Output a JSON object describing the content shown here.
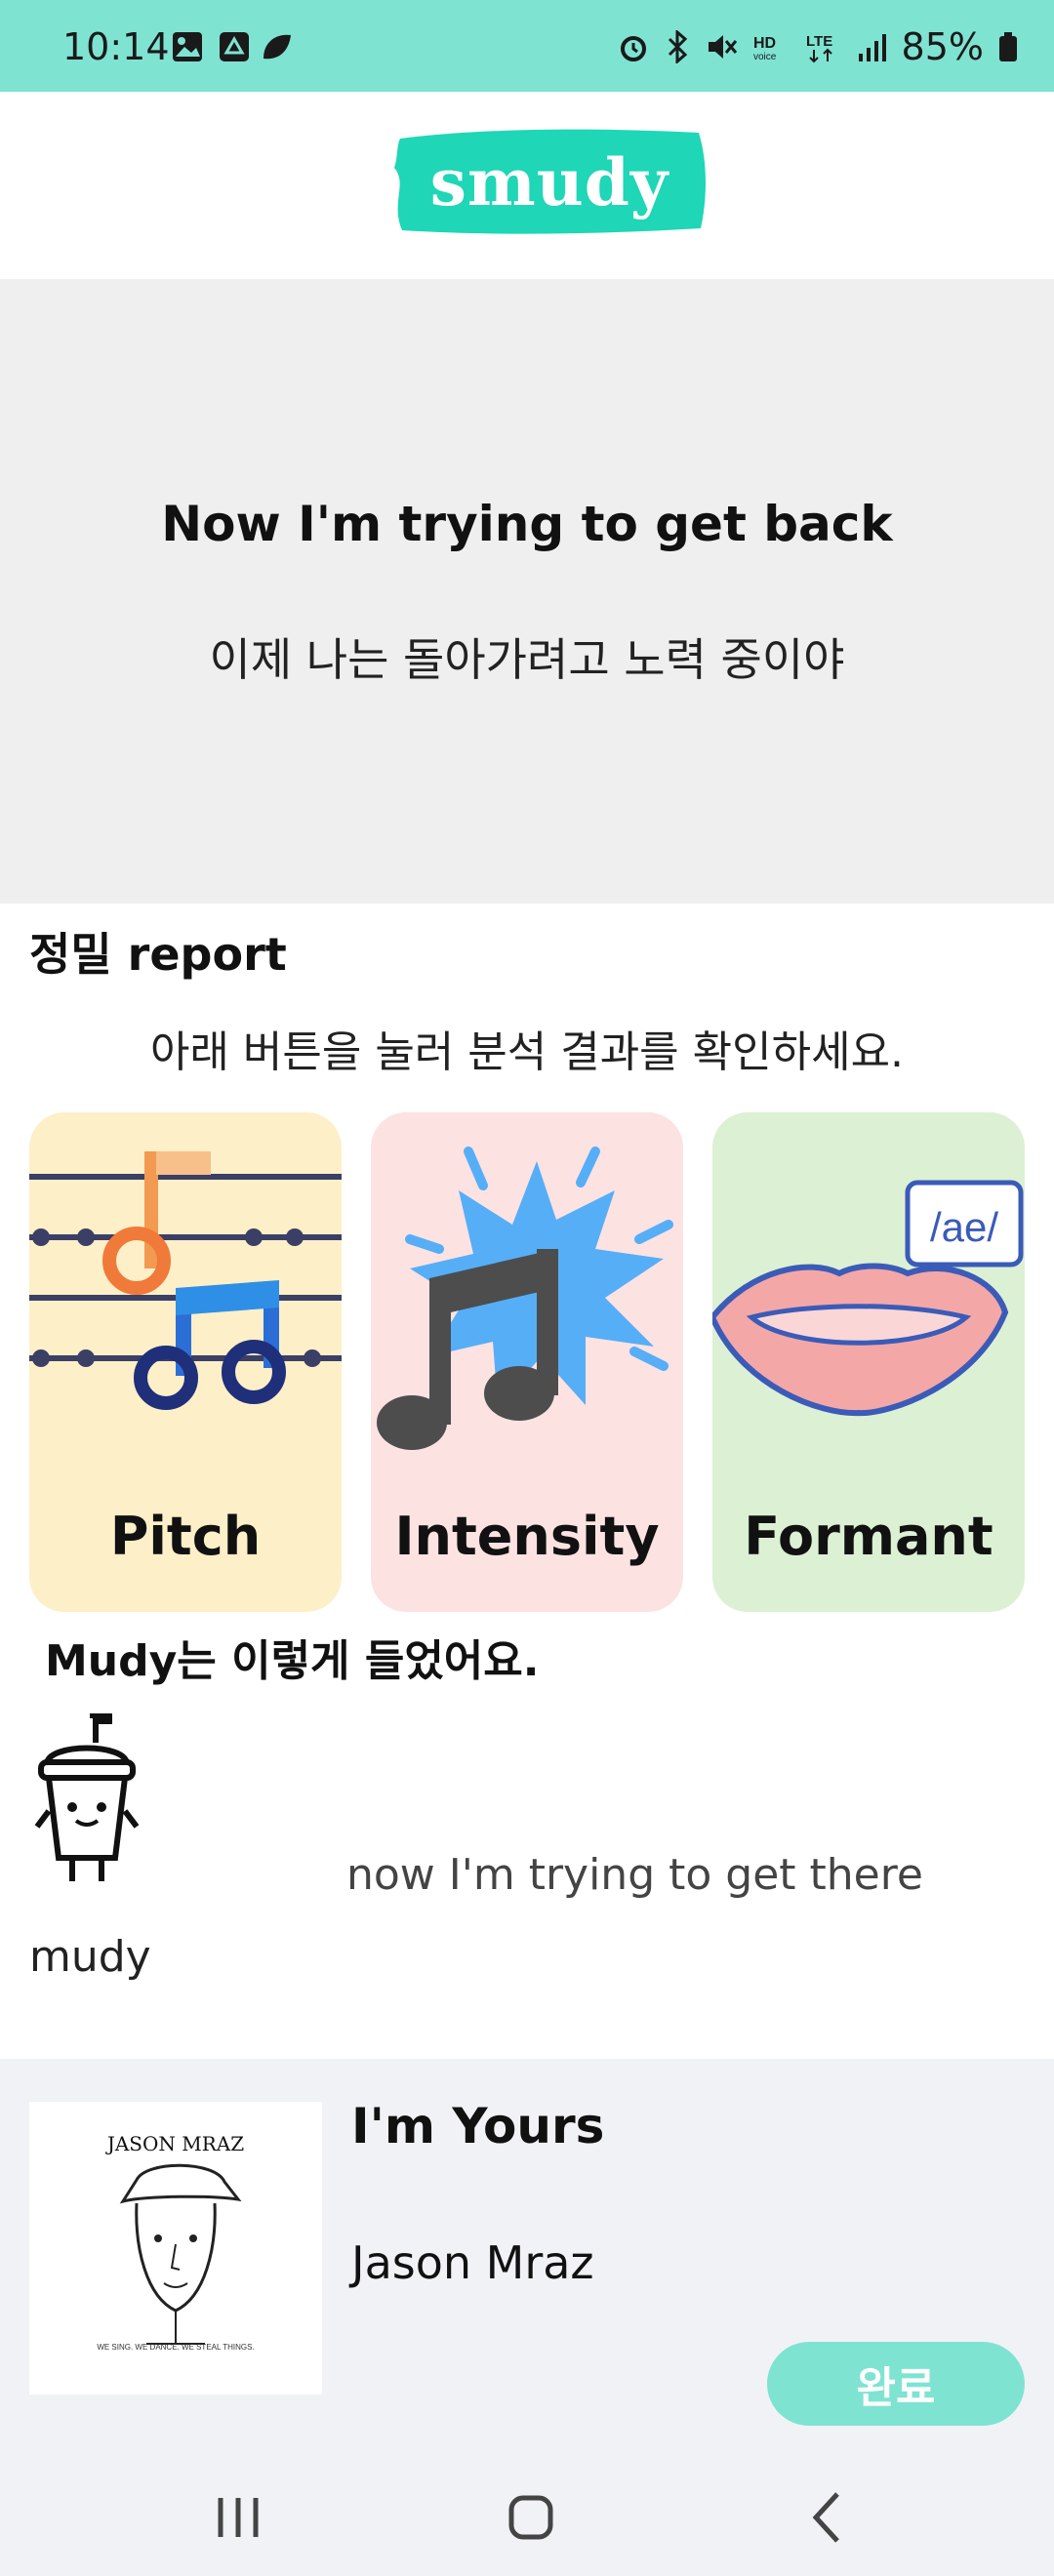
{
  "status_bar": {
    "time": "10:14",
    "battery": "85%"
  },
  "header": {
    "logo_text": "smudy",
    "brand_color": "#1fd6b6"
  },
  "lyric": {
    "english": "Now I'm trying to get back",
    "korean": "이제 나는 돌아가려고 노력 중이야"
  },
  "report": {
    "title": "정밀 report",
    "description": "아래 버튼을 눌러 분석 결과를 확인하세요.",
    "cards": [
      {
        "label": "Pitch",
        "icon": "pitch-music-notes-icon",
        "bg": "#fdefc7"
      },
      {
        "label": "Intensity",
        "icon": "intensity-burst-icon",
        "bg": "#fde2e2"
      },
      {
        "label": "Formant",
        "icon": "formant-lips-icon",
        "bg": "#dcf0d4",
        "bubble": "/ae/"
      }
    ]
  },
  "heard": {
    "title": "Mudy는 이렇게 들었어요.",
    "mascot_name": "mudy",
    "text": "now I'm trying to get there"
  },
  "song": {
    "title": "I'm Yours",
    "artist": "Jason Mraz",
    "album_art_text": "JASON MRAZ",
    "album_art_subtext": "WE SING. WE DANCE. WE STEAL THINGS."
  },
  "actions": {
    "done_label": "완료"
  },
  "colors": {
    "accent": "#7fe3d2"
  }
}
